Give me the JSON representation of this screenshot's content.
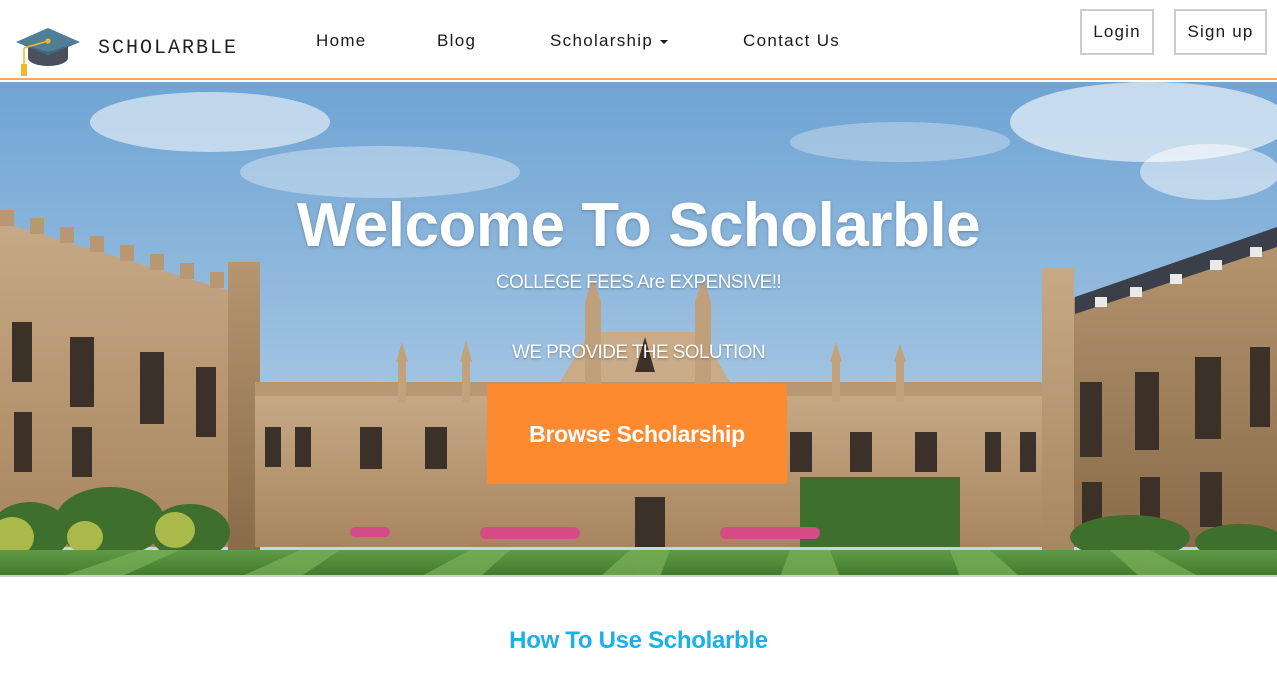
{
  "brand": {
    "name": "SCHOLARBLE",
    "logo_icon": "graduation-cap-icon"
  },
  "nav": {
    "home": "Home",
    "blog": "Blog",
    "scholarship": "Scholarship",
    "contact": "Contact Us"
  },
  "auth": {
    "login": "Login",
    "signup": "Sign up"
  },
  "hero": {
    "title": "Welcome To Scholarble",
    "subtitle_1": "COLLEGE FEES Are EXPENSIVE!!",
    "subtitle_2": "WE PROVIDE THE SOLUTION",
    "cta": "Browse Scholarship",
    "background": "college-quad-photo"
  },
  "section": {
    "title": "How To Use Scholarble"
  },
  "colors": {
    "accent_orange": "#fd8a2e",
    "section_blue": "#1cb0e8",
    "nav_divider": "#f0a86a"
  }
}
